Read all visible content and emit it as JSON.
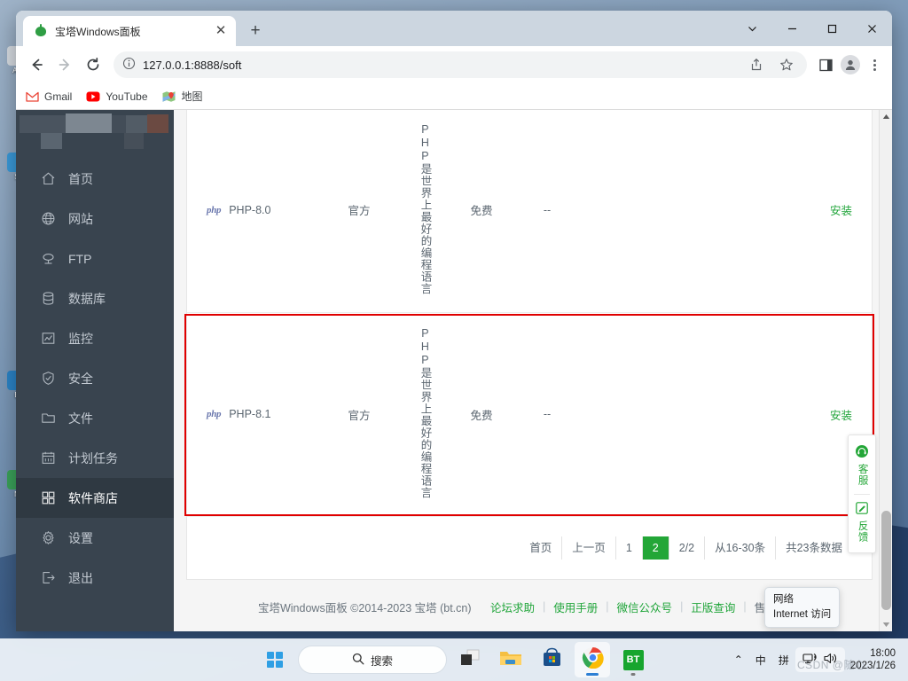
{
  "desktop": {
    "icons": [
      {
        "label": "Ad",
        "color": "#d8dde3"
      },
      {
        "label": "S",
        "color": "#3a9ad9"
      },
      {
        "label": "E",
        "color": "#2b84c7"
      },
      {
        "label": "N",
        "color": "#3ba35a"
      }
    ]
  },
  "browser": {
    "tab": {
      "title": "宝塔Windows面板",
      "close_label": "✕",
      "favicon": "bt-panel-icon"
    },
    "new_tab_label": "+",
    "window_controls": {
      "chevron": "⌄",
      "minimize": "—",
      "maximize": "▢",
      "close": "✕"
    },
    "toolbar": {
      "back": "←",
      "forward": "→",
      "reload": "⟳",
      "url": "127.0.0.1:8888/soft",
      "info_icon": "ⓘ"
    },
    "bookmarks": [
      {
        "label": "Gmail",
        "icon": "gmail-icon"
      },
      {
        "label": "YouTube",
        "icon": "youtube-icon"
      },
      {
        "label": "地图",
        "icon": "maps-icon"
      }
    ]
  },
  "sidebar": {
    "items": [
      {
        "label": "首页",
        "icon": "home-icon",
        "active": false
      },
      {
        "label": "网站",
        "icon": "globe-icon",
        "active": false
      },
      {
        "label": "FTP",
        "icon": "ftp-icon",
        "active": false
      },
      {
        "label": "数据库",
        "icon": "database-icon",
        "active": false
      },
      {
        "label": "监控",
        "icon": "monitor-icon",
        "active": false
      },
      {
        "label": "安全",
        "icon": "shield-icon",
        "active": false
      },
      {
        "label": "文件",
        "icon": "folder-icon",
        "active": false
      },
      {
        "label": "计划任务",
        "icon": "calendar-icon",
        "active": false
      },
      {
        "label": "软件商店",
        "icon": "grid-icon",
        "active": true
      },
      {
        "label": "设置",
        "icon": "gear-icon",
        "active": false
      },
      {
        "label": "退出",
        "icon": "logout-icon",
        "active": false
      }
    ]
  },
  "table": {
    "rows": [
      {
        "icon": "php",
        "name": "PHP-8.0",
        "source": "官方",
        "description": "PHP是世界上最好的编程语言",
        "price": "免费",
        "extra": "--",
        "action": "安装",
        "highlighted": false
      },
      {
        "icon": "php",
        "name": "PHP-8.1",
        "source": "官方",
        "description": "PHP是世界上最好的编程语言",
        "price": "免费",
        "extra": "--",
        "action": "安装",
        "highlighted": true
      }
    ]
  },
  "pagination": {
    "first": "首页",
    "prev": "上一页",
    "page_1": "1",
    "page_2": "2",
    "page_of": "2/2",
    "range": "从16-30条",
    "total": "共23条数据",
    "active_page": "2",
    "active_color": "#23a637"
  },
  "service_panel": {
    "support": {
      "label": "客服",
      "icon": "headset-icon"
    },
    "feedback": {
      "label": "反馈",
      "icon": "pencil-icon"
    },
    "color": "#23a637"
  },
  "footer": {
    "copyright": "宝塔Windows面板 ©2014-2023 宝塔 (bt.cn)",
    "links": [
      "论坛求助",
      "使用手册",
      "微信公众号",
      "正版查询",
      "售后QQ群:"
    ],
    "separator": "|"
  },
  "tray_tooltip": {
    "line1": "网络",
    "line2": "Internet 访问"
  },
  "taskbar": {
    "start": {
      "name": "start-button",
      "icon": "windows-logo-icon"
    },
    "search_label": "搜索",
    "buttons": [
      {
        "name": "task-view",
        "icon": "task-view-icon"
      },
      {
        "name": "file-explorer",
        "icon": "folder-icon"
      },
      {
        "name": "microsoft-store",
        "icon": "store-icon"
      },
      {
        "name": "google-chrome",
        "icon": "chrome-icon",
        "running": true
      },
      {
        "name": "bt-panel",
        "icon": "bt-icon",
        "label": "BT",
        "running": true
      }
    ],
    "tray": {
      "chevron": "⌃",
      "ime_mode": "中",
      "ime_pinyin": "拼",
      "network_icon": "network-icon",
      "volume_icon": "volume-icon",
      "time": "18:00",
      "date": "2023/1/26"
    }
  },
  "watermark": "CSDN @随心..."
}
